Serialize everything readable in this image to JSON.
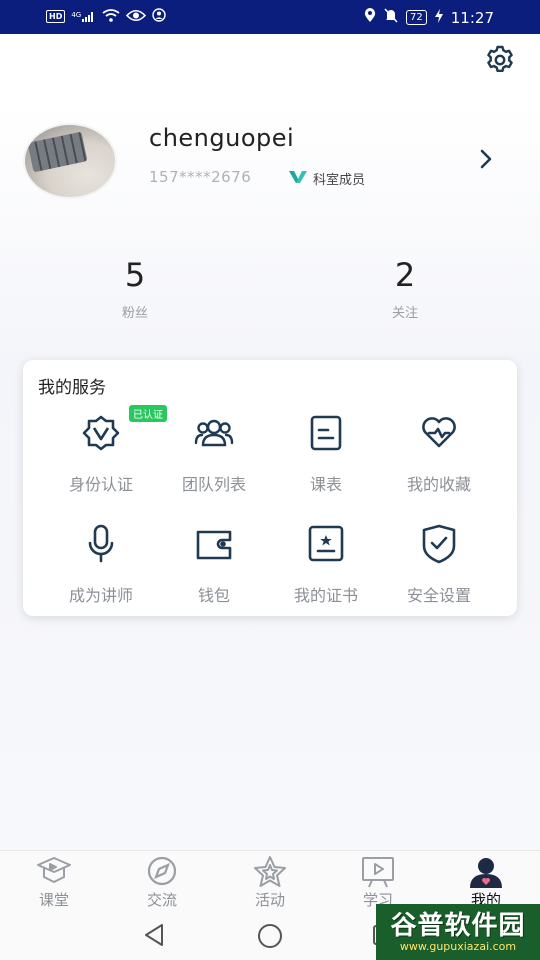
{
  "status_bar": {
    "left_icons": [
      "hd-icon",
      "4g-signal-icon",
      "wifi-icon",
      "eye-icon",
      "user-circle-icon"
    ],
    "network_label": "4G",
    "hd_label": "HD",
    "right_icons": [
      "location-icon",
      "mute-icon",
      "battery-icon",
      "charging-icon"
    ],
    "battery": "72",
    "time": "11:27",
    "background": "#0b1e7d"
  },
  "profile": {
    "username": "chenguopei",
    "phone": "157****2676",
    "role": "科室成员",
    "role_icon_color": "#2ec3b4"
  },
  "stats": [
    {
      "value": "5",
      "label": "粉丝"
    },
    {
      "value": "2",
      "label": "关注"
    }
  ],
  "services": {
    "title": "我的服务",
    "verified_badge": "已认证",
    "items": [
      {
        "label": "身份认证",
        "icon": "badge-check-icon"
      },
      {
        "label": "团队列表",
        "icon": "team-icon"
      },
      {
        "label": "课表",
        "icon": "schedule-icon"
      },
      {
        "label": "我的收藏",
        "icon": "heart-icon"
      },
      {
        "label": "成为讲师",
        "icon": "microphone-icon"
      },
      {
        "label": "钱包",
        "icon": "wallet-icon"
      },
      {
        "label": "我的证书",
        "icon": "certificate-icon"
      },
      {
        "label": "安全设置",
        "icon": "shield-check-icon"
      }
    ]
  },
  "bottom_nav": [
    {
      "label": "课堂",
      "icon": "classroom-icon"
    },
    {
      "label": "交流",
      "icon": "compass-icon"
    },
    {
      "label": "活动",
      "icon": "star-icon"
    },
    {
      "label": "学习",
      "icon": "video-board-icon"
    },
    {
      "label": "我的",
      "icon": "profile-icon",
      "active": true
    }
  ],
  "watermark": {
    "name": "谷普软件园",
    "url": "www.gupuxiazai.com"
  },
  "colors": {
    "accent": "#1f3a52",
    "verified_green": "#29c85f",
    "muted_text": "#8c9097"
  }
}
